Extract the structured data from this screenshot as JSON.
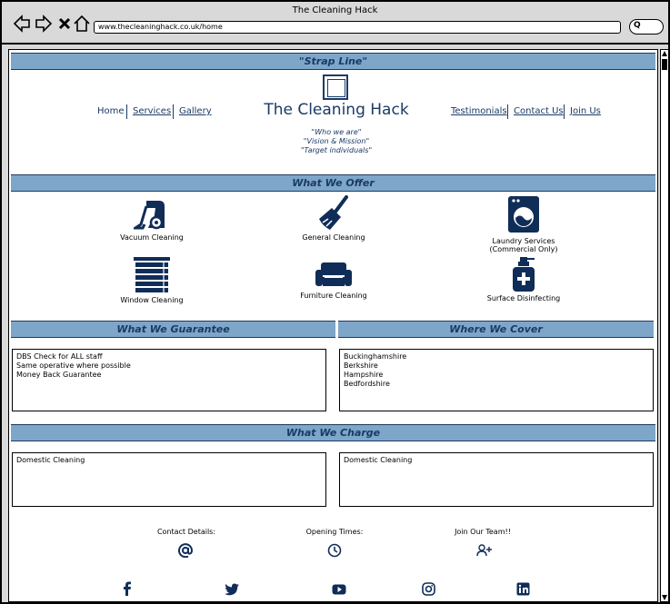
{
  "browser": {
    "title": "The Cleaning Hack",
    "url": "www.thecleaninghack.co.uk/home",
    "search_glyph": "Q"
  },
  "header": {
    "strap_line": "\"Strap Line\"",
    "brand": "The Cleaning Hack",
    "nav_left": [
      "Home",
      "Services",
      "Gallery"
    ],
    "nav_right": [
      "Testimonials",
      "Contact Us",
      "Join Us"
    ],
    "taglines": [
      "\"Who we are\"",
      "\"Vision & Mission\"",
      "\"Target individuals\""
    ]
  },
  "offer": {
    "heading": "What We Offer",
    "services": [
      {
        "label": "Vacuum Cleaning",
        "icon": "vacuum-icon"
      },
      {
        "label": "General Cleaning",
        "icon": "broom-icon"
      },
      {
        "label": "Laundry Services",
        "sublabel": "(Commercial Only)",
        "icon": "washing-machine-icon"
      },
      {
        "label": "Window Cleaning",
        "icon": "window-blinds-icon"
      },
      {
        "label": "Furniture Cleaning",
        "icon": "sofa-icon"
      },
      {
        "label": "Surface Disinfecting",
        "icon": "spray-bottle-icon"
      }
    ]
  },
  "guarantee": {
    "heading": "What We Guarantee",
    "items": [
      "DBS Check for ALL staff",
      "Same operative where possible",
      "Money Back Guarantee"
    ]
  },
  "cover": {
    "heading": "Where We Cover",
    "items": [
      "Buckinghamshire",
      "Berkshire",
      "Hampshire",
      "Bedfordshire"
    ]
  },
  "charge": {
    "heading": "What We Charge",
    "left": "Domestic Cleaning",
    "right": "Domestic Cleaning"
  },
  "footer": {
    "contact": "Contact Details:",
    "opening": "Opening Times:",
    "join": "Join Our Team!!",
    "social": [
      "facebook-icon",
      "twitter-icon",
      "youtube-icon",
      "instagram-icon",
      "linkedin-icon"
    ]
  },
  "colors": {
    "band": "#7ea6c9",
    "brand": "#1a3a66",
    "icon": "#0f2d57"
  }
}
